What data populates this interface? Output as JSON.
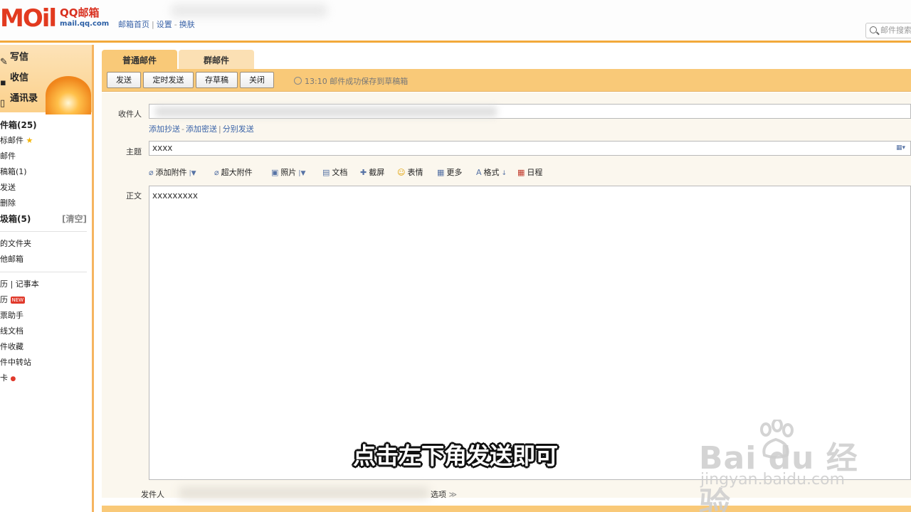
{
  "header": {
    "logo_mark": "MOil",
    "logo_brand": "QQ邮箱",
    "logo_domain": "mail.qq.com",
    "links": [
      "邮箱首页",
      "设置",
      "换肤"
    ],
    "search_placeholder": "邮件搜索"
  },
  "sidebar": {
    "actions": [
      "写信",
      "收信",
      "通讯录"
    ],
    "folders": [
      {
        "label": "件箱(25)",
        "bold": true
      },
      {
        "label": "标邮件",
        "star": "★"
      },
      {
        "label": "邮件"
      },
      {
        "label": "稿箱(1)"
      },
      {
        "label": "发送"
      },
      {
        "label": "删除"
      },
      {
        "label": "圾箱(5)",
        "bold": true,
        "action": "[清空]"
      }
    ],
    "folders2": [
      "的文件夹",
      "他邮箱"
    ],
    "tools": [
      {
        "label": "历  |  记事本"
      },
      {
        "label": "历",
        "badge": "NEW"
      },
      {
        "label": "票助手"
      },
      {
        "label": "线文档"
      },
      {
        "label": "件收藏"
      },
      {
        "label": "件中转站"
      },
      {
        "label": "卡",
        "dot": "●"
      }
    ]
  },
  "compose": {
    "tabs": [
      "普通邮件",
      "群邮件"
    ],
    "toolbar": {
      "send": "发送",
      "scheduled_send": "定时发送",
      "save_draft": "存草稿",
      "close": "关闭",
      "status": "13:10 邮件成功保存到草稿箱"
    },
    "to_label": "收件人",
    "recipient_links": [
      "添加抄送",
      "添加密送",
      "分别发送"
    ],
    "subject_label": "主题",
    "subject_value": "xxxx",
    "editor_tools": [
      "添加附件",
      "超大附件",
      "照片",
      "文档",
      "截屏",
      "表情",
      "更多",
      "格式",
      "日程"
    ],
    "body_label": "正文",
    "body_value": "xxxxxxxxx",
    "sender_label": "发件人",
    "options_label": "选项"
  },
  "overlay": {
    "subtitle": "点击左下角发送即可",
    "watermark_main": "Bai  du 经验",
    "watermark_sub": "jingyan.baidu.com"
  }
}
